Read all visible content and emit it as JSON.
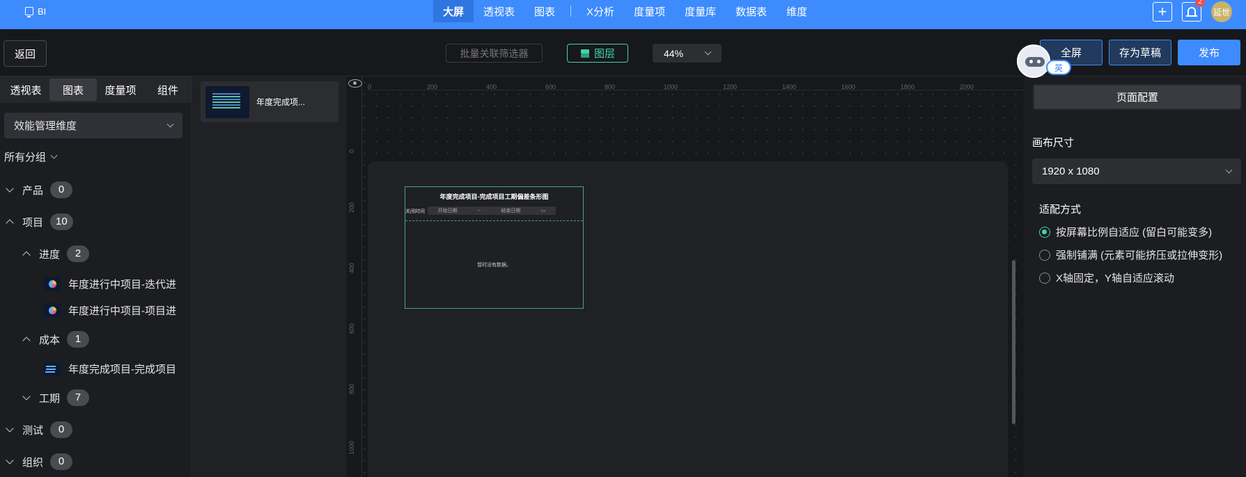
{
  "topnav": {
    "brand": "BI",
    "tabs": [
      "大屏",
      "透视表",
      "图表",
      "X分析",
      "度量项",
      "度量库",
      "数据表",
      "维度"
    ],
    "active_tab": "大屏",
    "notification_count": "2",
    "avatar_text": "延世"
  },
  "toolbar": {
    "back": "返回",
    "batch_filter": "批量关联筛选器",
    "layers": "图层",
    "zoom": "44%",
    "fullscreen": "全屏",
    "save_draft": "存为草稿",
    "publish": "发布",
    "assistant_lang": "英"
  },
  "left_panel": {
    "tabs": [
      "透视表",
      "图表",
      "度量项",
      "组件"
    ],
    "active_tab": "图表",
    "dimension_select": "效能管理维度",
    "all_groups": "所有分组",
    "tree": [
      {
        "label": "产品",
        "count": "0",
        "expanded": false
      },
      {
        "label": "项目",
        "count": "10",
        "expanded": true
      },
      {
        "label": "进度",
        "count": "2",
        "expanded": true
      },
      {
        "label": "年度进行中项目-迭代进",
        "leaf": true,
        "icon": "pie-chart-thumb"
      },
      {
        "label": "年度进行中项目-项目进",
        "leaf": true,
        "icon": "pie-chart-thumb"
      },
      {
        "label": "成本",
        "count": "1",
        "expanded": true
      },
      {
        "label": "年度完成项目-完成项目",
        "leaf": true,
        "icon": "bar-chart-thumb"
      },
      {
        "label": "工期",
        "count": "7",
        "expanded": false
      },
      {
        "label": "测试",
        "count": "0",
        "expanded": false
      },
      {
        "label": "组织",
        "count": "0",
        "expanded": false
      }
    ]
  },
  "layers_panel": {
    "items": [
      {
        "label": "年度完成项..."
      }
    ]
  },
  "canvas": {
    "ruler_x": [
      "0",
      "200",
      "400",
      "600",
      "800",
      "1000",
      "1200",
      "1400",
      "1600",
      "1800",
      "2000"
    ],
    "ruler_y": [
      "0",
      "200",
      "400",
      "600",
      "800",
      "1000"
    ],
    "widget": {
      "title": "年度完成项目-完成项目工期偏差条形图",
      "filter_label": "关闭时间",
      "start_placeholder": "开始日期",
      "range_sep": "~",
      "end_placeholder": "结束日期",
      "empty_text": "暂时没有数据。"
    }
  },
  "right_panel": {
    "page_config": "页面配置",
    "canvas_size_label": "画布尺寸",
    "canvas_size": "1920 x 1080",
    "fit_label": "适配方式",
    "fit_options": [
      {
        "label": "按屏幕比例自适应 (留白可能变多)",
        "selected": true
      },
      {
        "label": "强制铺满 (元素可能挤压或拉伸变形)",
        "selected": false
      },
      {
        "label": "X轴固定，Y轴自适应滚动",
        "selected": false
      }
    ]
  },
  "colors": {
    "brand_blue": "#3d8bfd",
    "accent_teal": "#3fd3b0",
    "background": "#1b1c1f"
  }
}
